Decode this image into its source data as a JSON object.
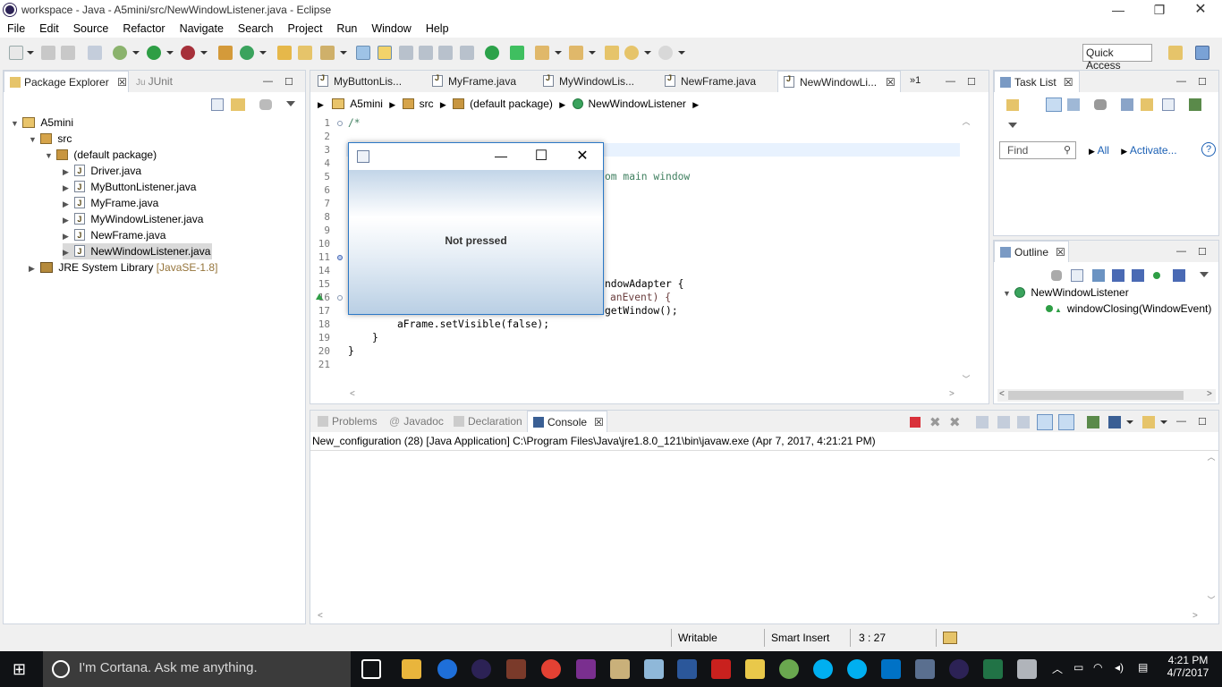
{
  "window": {
    "title": "workspace - Java - A5mini/src/NewWindowListener.java - Eclipse",
    "minimize": "—",
    "maximize": "❐",
    "close": "✕"
  },
  "menu": [
    "File",
    "Edit",
    "Source",
    "Refactor",
    "Navigate",
    "Search",
    "Project",
    "Run",
    "Window",
    "Help"
  ],
  "quick_access": "Quick Access",
  "package_explorer": {
    "tabs": [
      {
        "label": "Package Explorer",
        "close": "☒"
      },
      {
        "label": "JUnit"
      }
    ],
    "project": "A5mini",
    "src": "src",
    "package": "(default package)",
    "files": [
      "Driver.java",
      "MyButtonListener.java",
      "MyFrame.java",
      "MyWindowListener.java",
      "NewFrame.java",
      "NewWindowListener.java"
    ],
    "library": "JRE System Library",
    "library_version": "[JavaSE-1.8]"
  },
  "editor": {
    "tabs": [
      "MyButtonLis...",
      "MyFrame.java",
      "MyWindowLis...",
      "NewFrame.java",
      "NewWindowLi..."
    ],
    "overflow": "»1",
    "breadcrumb": [
      "A5mini",
      "src",
      "(default package)",
      "NewWindowListener"
    ],
    "line_numbers": [
      "1",
      "2",
      "3",
      "4",
      "5",
      "6",
      "7",
      "8",
      "9",
      "10",
      "11",
      "14",
      "15",
      "16",
      "17",
      "18",
      "19",
      "20",
      "21"
    ],
    "code": {
      "l1": "/*",
      "l5_tail": "om main window",
      "l15_tail": "ndowAdapter {",
      "l16_tail": "anEvent) {",
      "l17_tail": "getWindow();",
      "l18": "aFrame.setVisible(false);",
      "l19": "}",
      "l20": "}"
    }
  },
  "dialog": {
    "label": "Not pressed",
    "min": "—",
    "max": "☐",
    "close": "✕"
  },
  "task_list": {
    "tab": "Task List",
    "find_placeholder": "Find",
    "all": "All",
    "activate": "Activate..."
  },
  "outline": {
    "tab": "Outline",
    "class": "NewWindowListener",
    "method": "windowClosing(WindowEvent)"
  },
  "bottom": {
    "tabs": [
      "Problems",
      "Javadoc",
      "Declaration",
      "Console"
    ],
    "console_header": "New_configuration (28) [Java Application] C:\\Program Files\\Java\\jre1.8.0_121\\bin\\javaw.exe (Apr 7, 2017, 4:21:21 PM)"
  },
  "status": {
    "writable": "Writable",
    "insert": "Smart Insert",
    "position": "3 : 27"
  },
  "taskbar": {
    "cortana": "I'm Cortana. Ask me anything.",
    "time": "4:21 PM",
    "date": "4/7/2017"
  },
  "colors": {
    "accent": "#2b78c6",
    "keyword": "#7f0055",
    "comment": "#3f7f5f",
    "field": "#0000c0"
  }
}
